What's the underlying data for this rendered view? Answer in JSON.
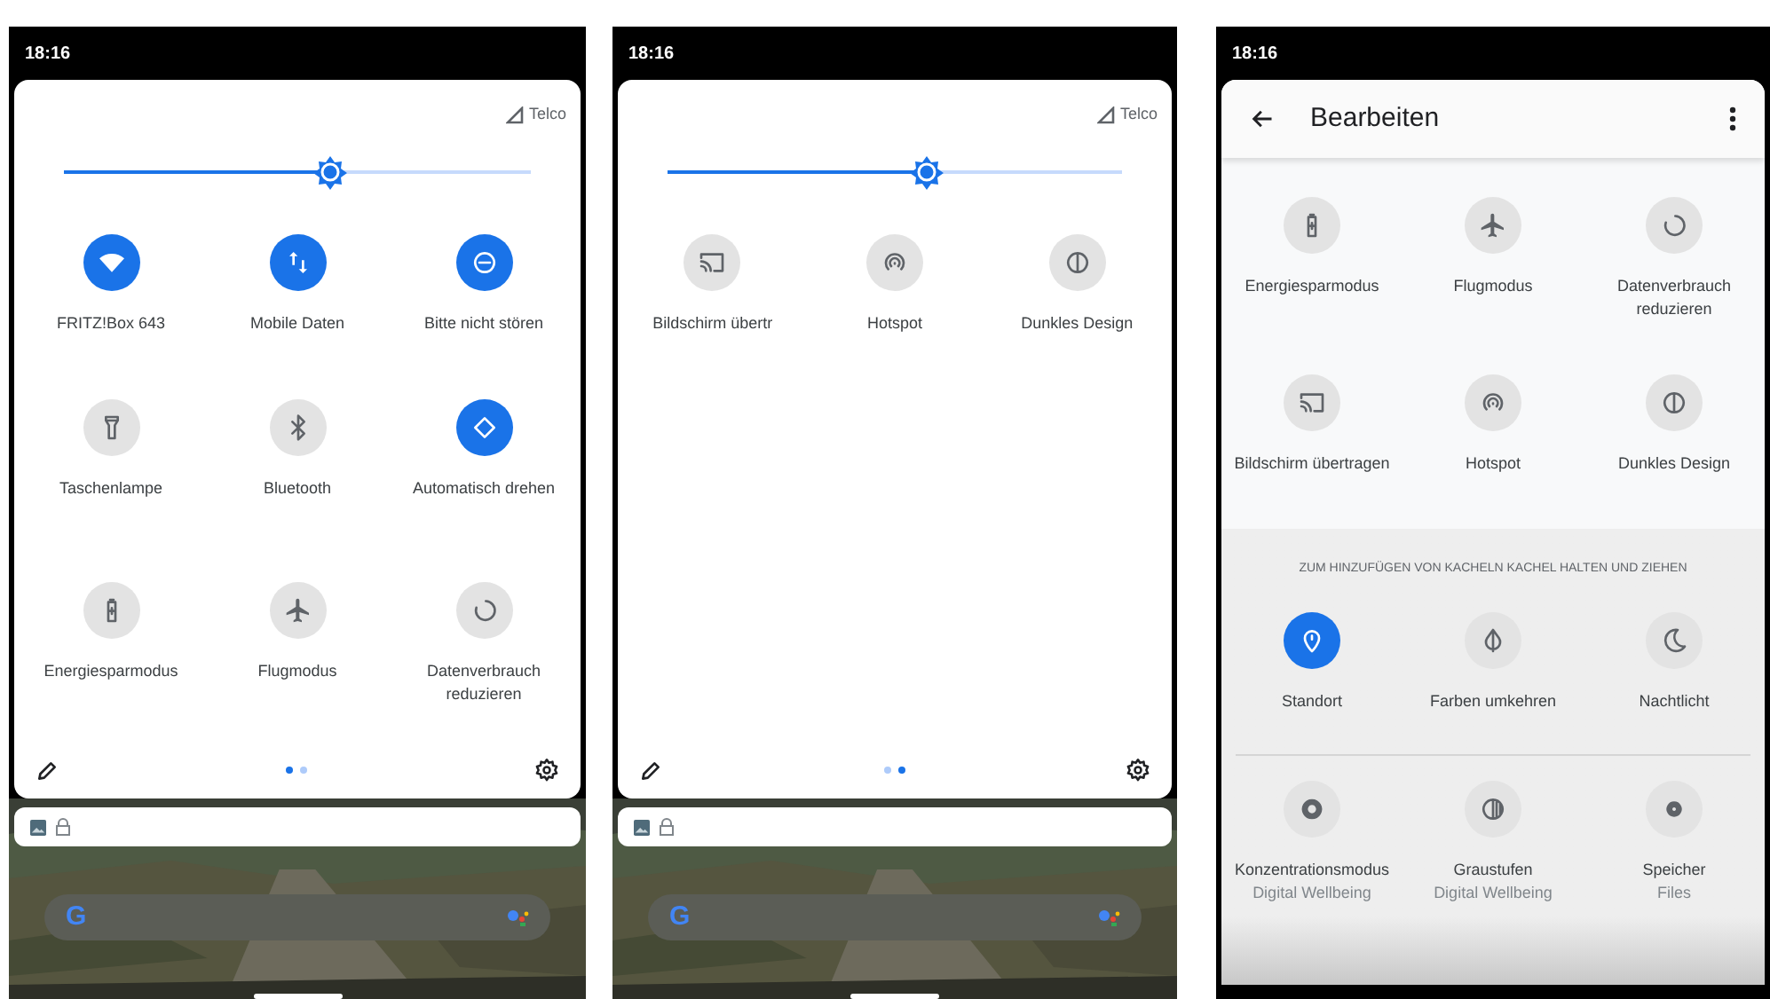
{
  "screens": [
    {
      "kind": "quick_settings",
      "time": "18:16",
      "carrier": "Telco",
      "brightness": {
        "level": 0.57
      },
      "tiles": [
        {
          "label": "FRITZ!Box 643",
          "on": true
        },
        {
          "label": "Mobile Daten",
          "on": true
        },
        {
          "label": "Bitte nicht stören",
          "on": true
        },
        {
          "label": "Taschenlampe",
          "on": false
        },
        {
          "label": "Bluetooth",
          "on": false
        },
        {
          "label": "Automatisch drehen",
          "on": true
        },
        {
          "label": "Energiesparmodus",
          "on": false
        },
        {
          "label": "Flugmodus",
          "on": false
        },
        {
          "label": "Datenverbrauch reduzieren",
          "on": false
        }
      ],
      "page_dots": [
        {
          "selected": true
        },
        {
          "selected": false
        }
      ],
      "search_logo": "G"
    },
    {
      "kind": "quick_settings",
      "time": "18:16",
      "carrier": "Telco",
      "brightness": {
        "level": 0.57
      },
      "tiles": [
        {
          "label": "Bildschirm übertr",
          "on": false
        },
        {
          "label": "Hotspot",
          "on": false
        },
        {
          "label": "Dunkles Design",
          "on": false
        }
      ],
      "page_dots": [
        {
          "selected": false
        },
        {
          "selected": true
        }
      ],
      "search_logo": "G"
    },
    {
      "kind": "edit",
      "time": "18:16",
      "title": "Bearbeiten",
      "active_tiles": [
        {
          "label": "Energiesparmodus",
          "on": false
        },
        {
          "label": "Flugmodus",
          "on": false
        },
        {
          "label": "Datenverbrauch reduzieren",
          "on": false
        },
        {
          "label": "Bildschirm übertragen",
          "on": false
        },
        {
          "label": "Hotspot",
          "on": false
        },
        {
          "label": "Dunkles Design",
          "on": false
        }
      ],
      "add_hint": "ZUM HINZUFÜGEN VON KACHELN KACHEL HALTEN UND ZIEHEN",
      "available_tiles": [
        {
          "label": "Standort",
          "on": true
        },
        {
          "label": "Farben umkehren",
          "on": false
        },
        {
          "label": "Nachtlicht",
          "on": false
        },
        {
          "label": "Konzentrationsmodus",
          "sublabel": "Digital Wellbeing",
          "on": false
        },
        {
          "label": "Graustufen",
          "sublabel": "Digital Wellbeing",
          "on": false
        },
        {
          "label": "Speicher",
          "sublabel": "Files",
          "on": false
        }
      ]
    }
  ]
}
